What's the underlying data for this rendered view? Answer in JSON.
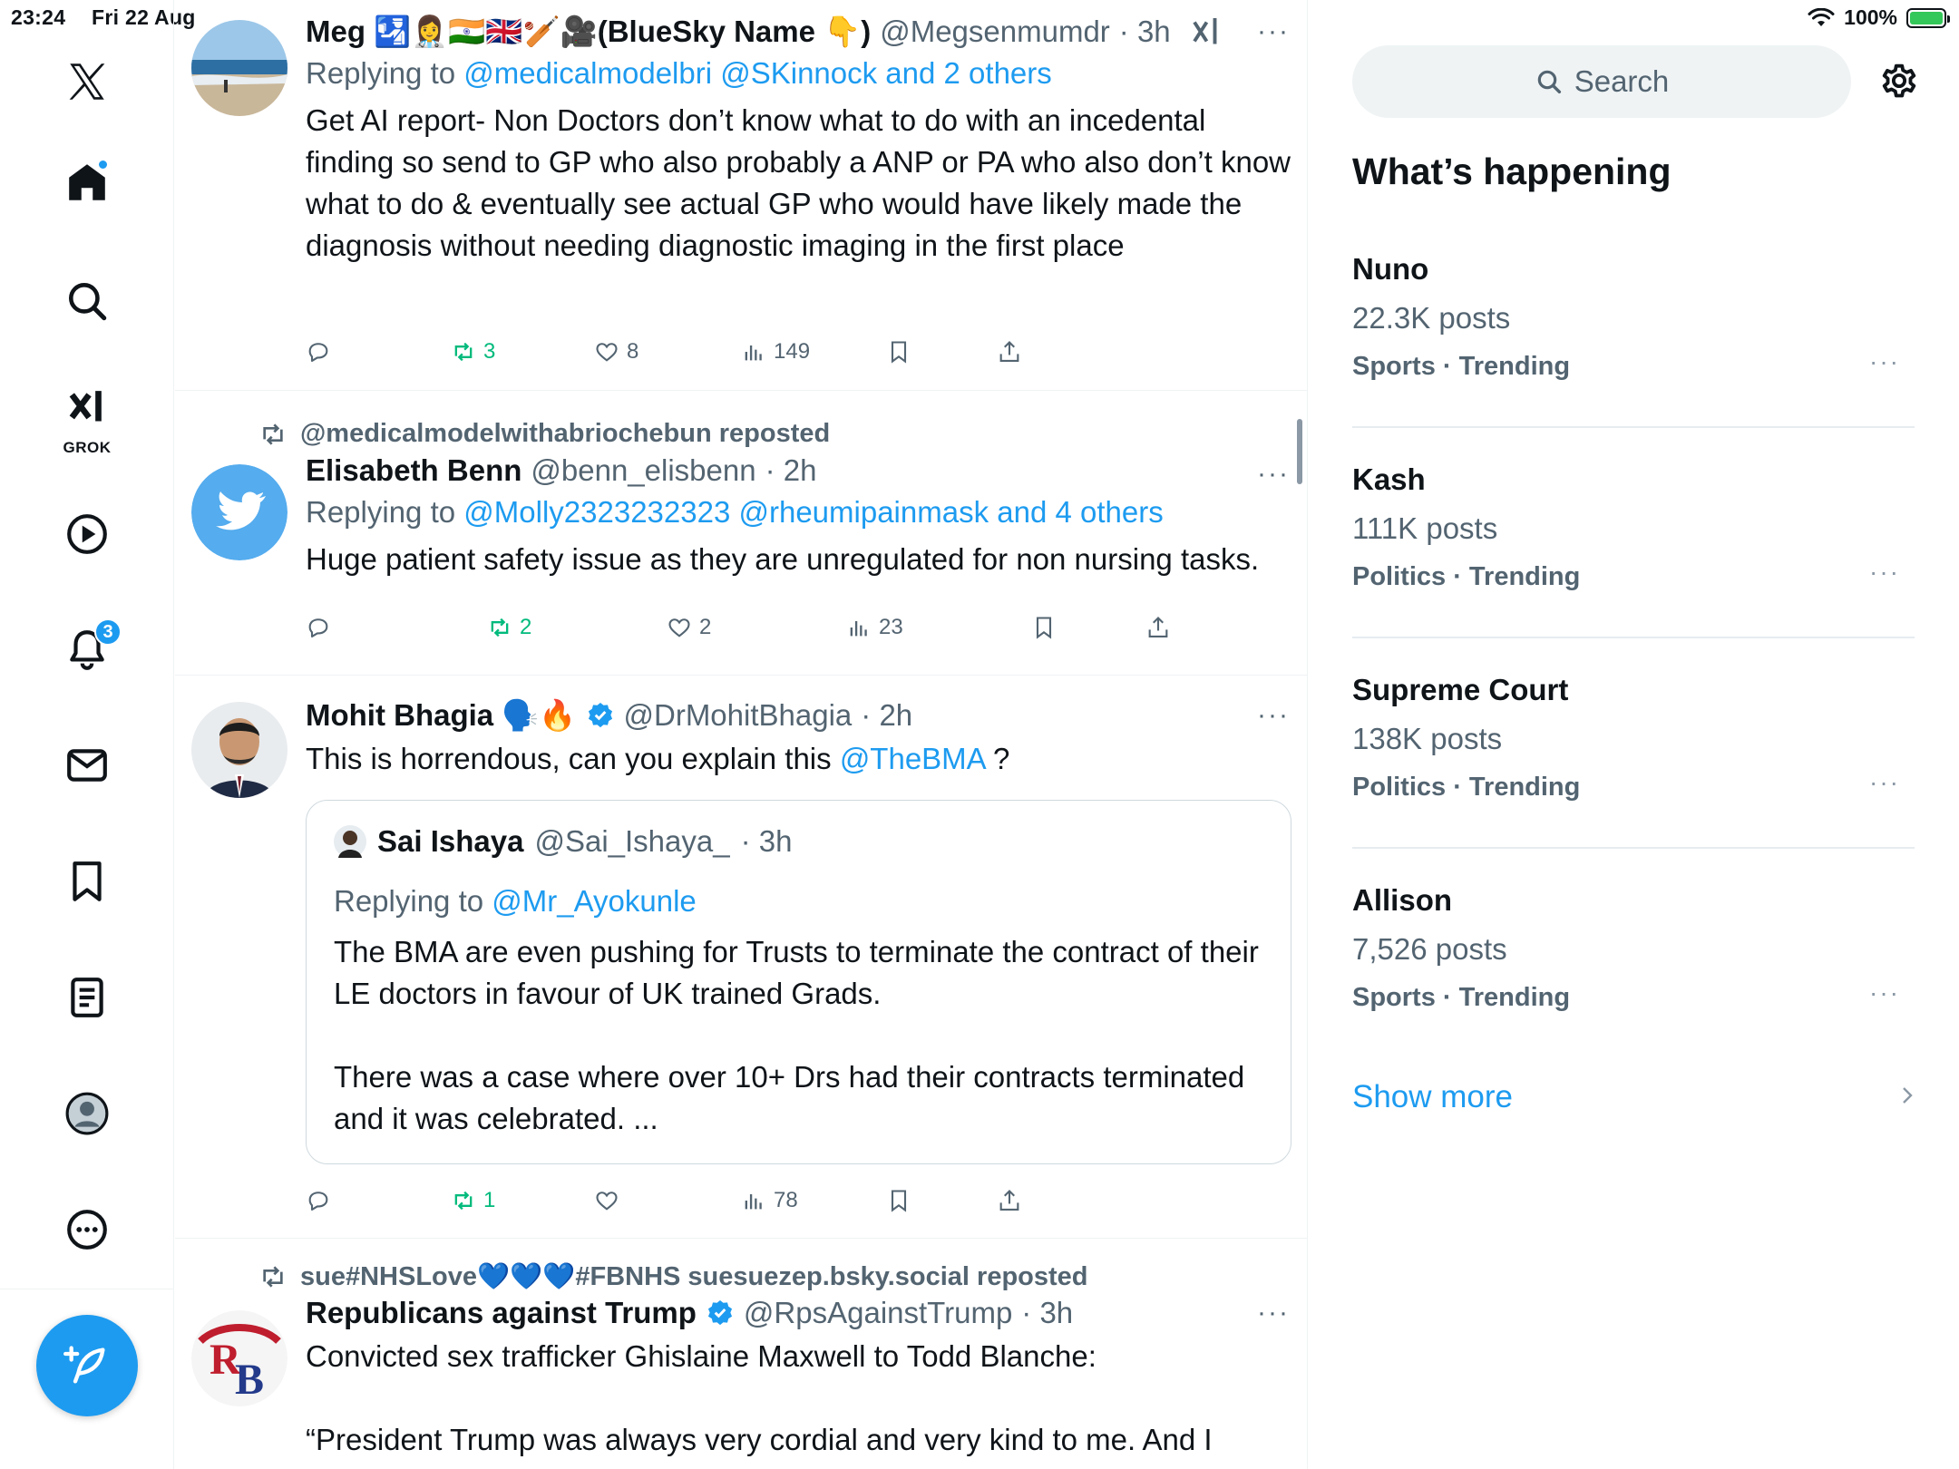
{
  "status_bar": {
    "time": "23:24",
    "date": "Fri 22 Aug",
    "battery": "100%"
  },
  "colors": {
    "accent": "#1d9bf0",
    "repost_green": "#00ba7c",
    "muted": "#536471"
  },
  "nav": {
    "items": [
      "x-logo",
      "home",
      "search",
      "grok",
      "video",
      "notifications",
      "messages",
      "bookmarks",
      "lists",
      "profile",
      "more"
    ],
    "grok_label": "GROK",
    "notifications_badge": "3"
  },
  "feed": {
    "tweets": [
      {
        "name": "Meg 🛂👩‍⚕️🇮🇳🇬🇧🏏🎥(BlueSky Name 👇)",
        "handle": "@Megsenmumdr",
        "time": "· 3h",
        "replying_label": "Replying to",
        "replying_to": "@medicalmodelbri @SKinnock and 2 others",
        "text": "Get AI report- Non Doctors don’t know what to do with an incedental finding so send to GP who also probably a ANP or PA who also don’t know what to do & eventually see actual GP who would have likely made the diagnosis without needing diagnostic imaging in the first place",
        "reposts": "3",
        "likes": "8",
        "views": "149"
      },
      {
        "reposted_by": "@medicalmodelwithabriochebun reposted",
        "name": "Elisabeth Benn",
        "handle": "@benn_elisbenn",
        "time": "· 2h",
        "replying_label": "Replying to",
        "replying_to": "@Molly2323232323 @rheumipainmask and 4 others",
        "text": "Huge patient safety issue as they are unregulated for non nursing tasks.",
        "reposts": "2",
        "likes": "2",
        "views": "23"
      },
      {
        "name": "Mohit Bhagia 🗣️🔥",
        "handle": "@DrMohitBhagia",
        "time": "· 2h",
        "text_before": "This is horrendous, can you explain this ",
        "mention": "@TheBMA",
        "text_after": " ?",
        "quote": {
          "name": "Sai Ishaya",
          "handle": "@Sai_Ishaya_",
          "time": "· 3h",
          "replying_label": "Replying to",
          "replying_to": "@Mr_Ayokunle",
          "para1": "The BMA are even pushing for Trusts to terminate the contract of their LE doctors in favour of UK trained Grads.",
          "para2": "There was a case where over 10+ Drs had their contracts terminated and it was celebrated. ..."
        },
        "reposts": "1",
        "views": "78"
      },
      {
        "reposted_by": "sue#NHSLove💙💙💙#FBNHS suesuezep.bsky.social reposted",
        "name": "Republicans against Trump",
        "handle": "@RpsAgainstTrump",
        "time": "· 3h",
        "text_line1": "Convicted sex trafficker Ghislaine Maxwell to Todd Blanche:",
        "text_line2": "“President Trump was always very cordial and very kind to me. And I"
      }
    ]
  },
  "sidebar": {
    "search_placeholder": "Search",
    "heading": "What’s happening",
    "trends": [
      {
        "name": "Nuno",
        "posts": "22.3K posts",
        "category": "Sports · Trending"
      },
      {
        "name": "Kash",
        "posts": "111K posts",
        "category": "Politics · Trending"
      },
      {
        "name": "Supreme Court",
        "posts": "138K posts",
        "category": "Politics · Trending"
      },
      {
        "name": "Allison",
        "posts": "7,526 posts",
        "category": "Sports · Trending"
      }
    ],
    "show_more": "Show more",
    "more_glyph": "···"
  }
}
